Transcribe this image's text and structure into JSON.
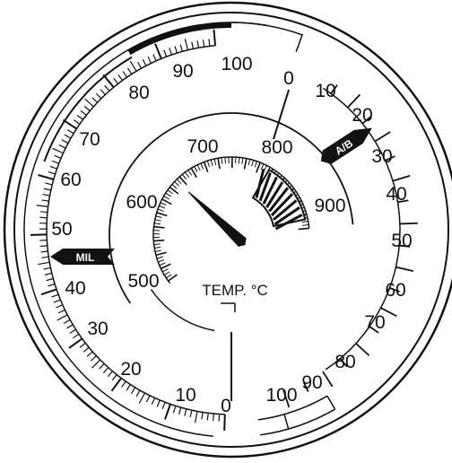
{
  "gauge": {
    "outer_scale_left": {
      "labels": [
        "0",
        "10",
        "20",
        "30",
        "40",
        "50",
        "60",
        "70",
        "80",
        "90",
        "100"
      ],
      "marker": "MIL"
    },
    "outer_scale_right": {
      "labels": [
        "0",
        "10",
        "20",
        "30",
        "40",
        "50",
        "60",
        "70",
        "80",
        "90",
        "100"
      ],
      "marker": "A/B"
    },
    "temperature_dial": {
      "labels": [
        "500",
        "600",
        "700",
        "800",
        "900"
      ],
      "unit_label": "TEMP. °C",
      "pointer_value": 650
    },
    "colors": {
      "ink": "#111111",
      "background": "#ffffff"
    }
  }
}
